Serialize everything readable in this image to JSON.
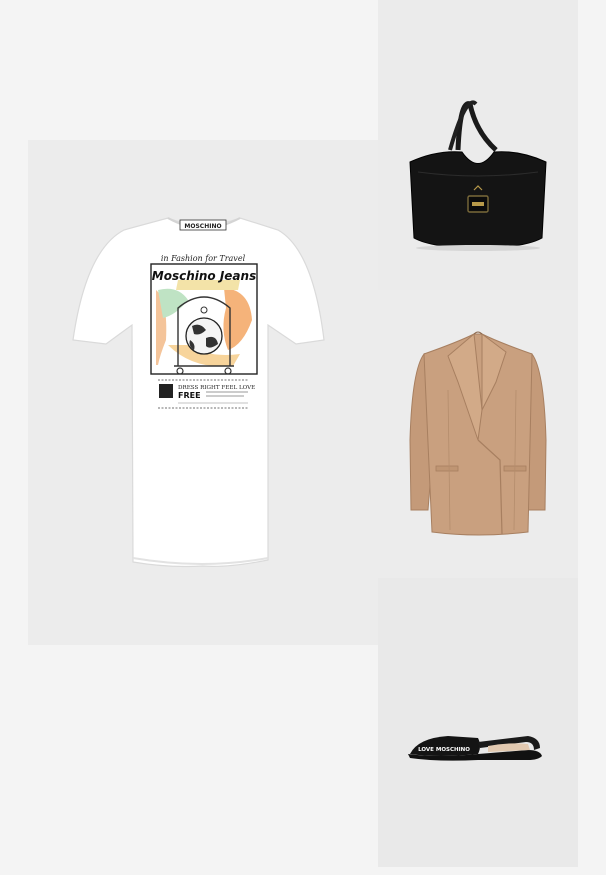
{
  "board": {
    "title": "",
    "colors": {
      "page_background": "#f4f4f4",
      "tile_background": "#ececec",
      "bag": "#141414",
      "blazer": "#c9a07f",
      "shoe": "#111111"
    }
  },
  "products": [
    {
      "slot": "dress",
      "icon": "tshirt-dress-image",
      "color": "#ffffff",
      "print": {
        "tagline": "in Fashion for Travel",
        "brand": "Moschino Jeans",
        "label": "MOSCHINO",
        "footer_line": "DRESS RIGHT FEEL LOVE",
        "footer_free": "FREE"
      }
    },
    {
      "slot": "bag",
      "icon": "handbag-image",
      "color": "#141414"
    },
    {
      "slot": "blazer",
      "icon": "blazer-image",
      "color": "#c9a07f"
    },
    {
      "slot": "shoe",
      "icon": "slingback-flat-image",
      "color": "#111111",
      "print": {
        "brand": "LOVE MOSCHINO"
      }
    }
  ]
}
